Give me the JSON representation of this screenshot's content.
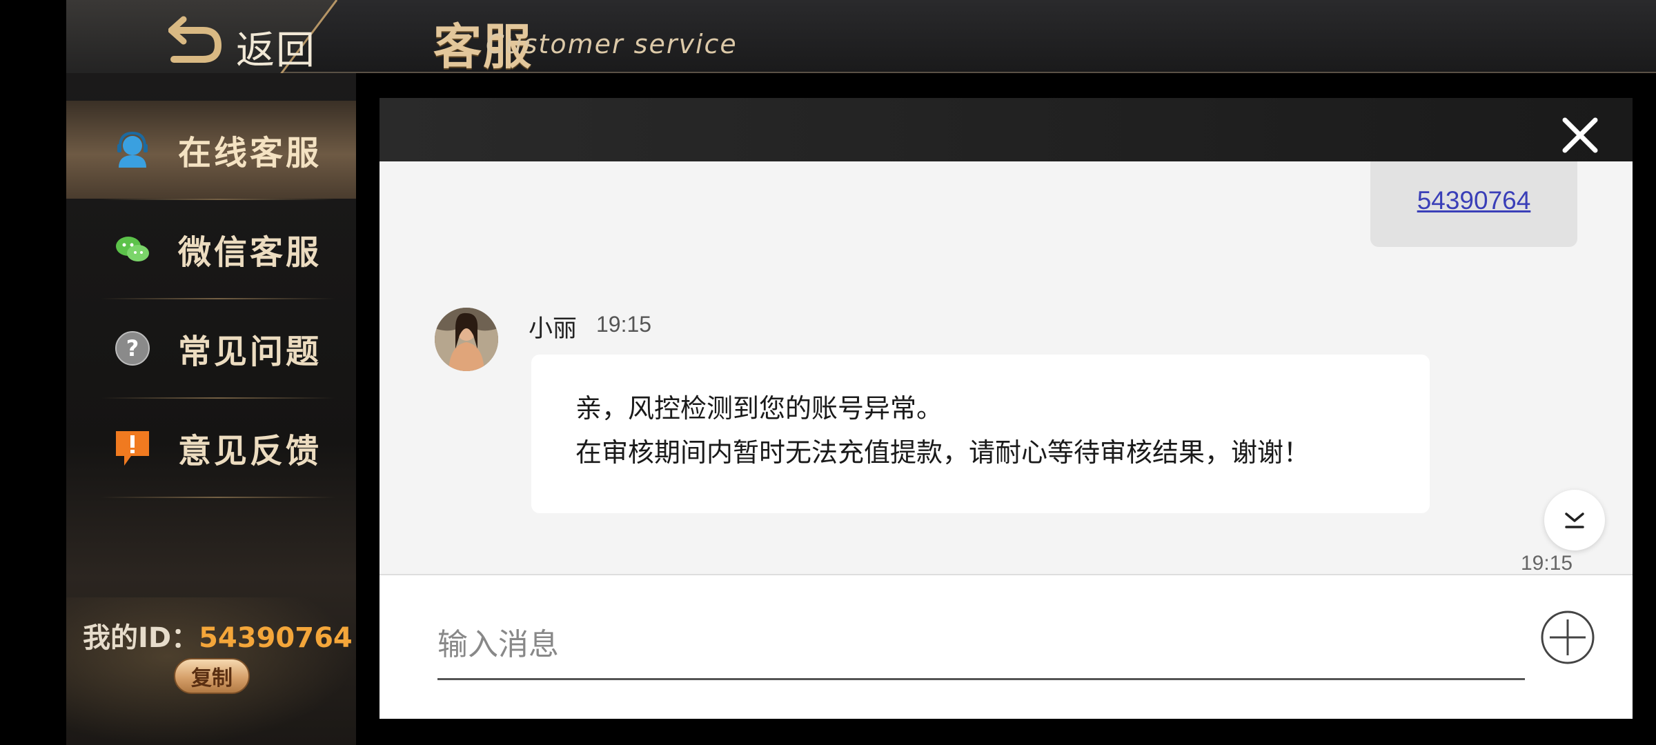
{
  "header": {
    "back_label": "返回",
    "title_cn": "客服",
    "title_en": "Customer service"
  },
  "sidebar": {
    "items": [
      {
        "label": "在线客服",
        "icon": "headset-icon",
        "active": true
      },
      {
        "label": "微信客服",
        "icon": "wechat-icon",
        "active": false
      },
      {
        "label": "常见问题",
        "icon": "question-icon",
        "active": false
      },
      {
        "label": "意见反馈",
        "icon": "feedback-icon",
        "active": false
      }
    ],
    "my_id_label": "我的ID：",
    "my_id_value": "54390764",
    "copy_label": "复制"
  },
  "chat": {
    "my_message": "54390764",
    "agent_name": "小丽",
    "agent_time": "19:15",
    "agent_message_line1": "亲，风控检测到您的账号异常。",
    "agent_message_line2": "在审核期间内暂时无法充值提款，请耐心等待审核结果，谢谢！",
    "bottom_time": "19:15",
    "input_placeholder": "输入消息"
  },
  "colors": {
    "accent_gold": "#e3c79b",
    "id_orange": "#f4a63a",
    "link_blue": "#3a3fb8"
  }
}
